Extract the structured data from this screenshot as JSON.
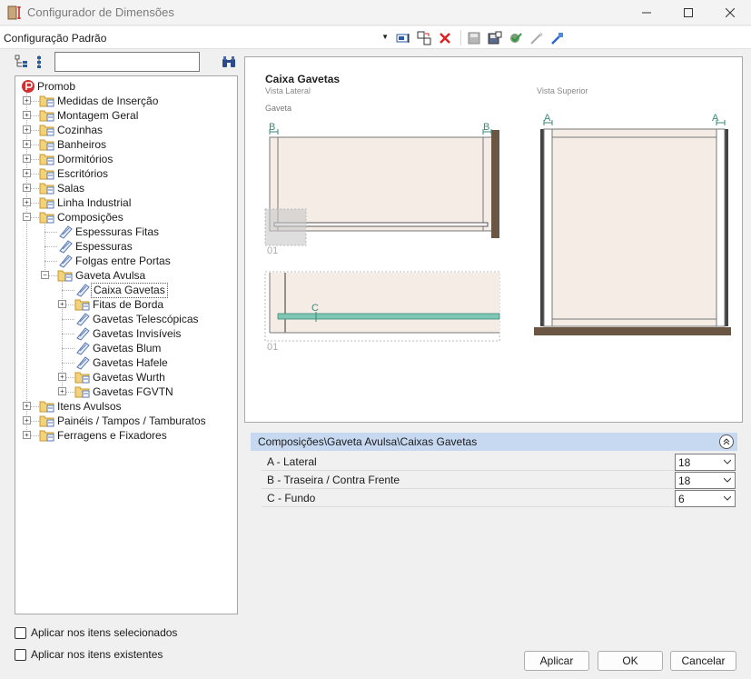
{
  "window": {
    "title": "Configurador de Dimensões",
    "controls": [
      "minimize",
      "maximize",
      "close"
    ]
  },
  "toolbar": {
    "configuration_value": "Configuração Padrão",
    "icons": [
      "rename-icon",
      "copy-config-icon",
      "delete-icon",
      "save-icon",
      "save-as-icon",
      "apply-check-icon",
      "import-icon",
      "export-icon"
    ]
  },
  "tree": {
    "root": "Promob",
    "items": [
      {
        "label": "Medidas de Inserção"
      },
      {
        "label": "Montagem Geral"
      },
      {
        "label": "Cozinhas"
      },
      {
        "label": "Banheiros"
      },
      {
        "label": "Dormitórios"
      },
      {
        "label": "Escritórios"
      },
      {
        "label": "Salas"
      },
      {
        "label": "Linha Industrial"
      },
      {
        "label": "Composições"
      },
      {
        "label": "Espessuras Fitas"
      },
      {
        "label": "Espessuras"
      },
      {
        "label": "Folgas entre Portas"
      },
      {
        "label": "Gaveta Avulsa"
      },
      {
        "label": "Caixa Gavetas"
      },
      {
        "label": "Fitas de Borda"
      },
      {
        "label": "Gavetas Telescópicas"
      },
      {
        "label": "Gavetas Invisíveis"
      },
      {
        "label": "Gavetas Blum"
      },
      {
        "label": "Gavetas Hafele"
      },
      {
        "label": "Gavetas Wurth"
      },
      {
        "label": "Gavetas FGVTN"
      },
      {
        "label": "Itens Avulsos"
      },
      {
        "label": "Painéis / Tampos / Tamburatos"
      },
      {
        "label": "Ferragens e Fixadores"
      }
    ]
  },
  "options": {
    "apply_selected": "Aplicar nos itens selecionados",
    "apply_existing": "Aplicar nos itens existentes"
  },
  "preview": {
    "title": "Caixa Gavetas",
    "side_view": "Vista Lateral",
    "top_view": "Vista Superior",
    "part_label": "Gaveta",
    "marker_a": "A",
    "marker_b": "B",
    "marker_c": "C",
    "detail_1": "01",
    "detail_2": "01"
  },
  "properties": {
    "path": "Composições\\Gaveta Avulsa\\Caixas Gavetas",
    "rows": [
      {
        "label": "A - Lateral",
        "value": "18"
      },
      {
        "label": "B - Traseira / Contra Frente",
        "value": "18"
      },
      {
        "label": "C - Fundo",
        "value": "6"
      }
    ]
  },
  "buttons": {
    "apply": "Aplicar",
    "ok": "OK",
    "cancel": "Cancelar"
  },
  "colors": {
    "wood_light": "#f5ece6",
    "wood_dark": "#6b5644",
    "accent_teal": "#7fc6b5",
    "header_blue": "#c6d9f1"
  }
}
